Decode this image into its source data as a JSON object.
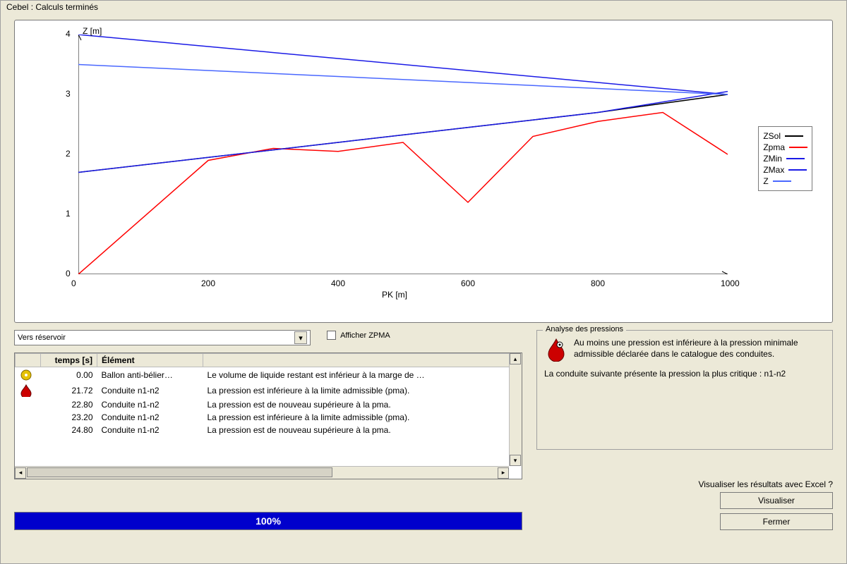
{
  "window": {
    "title": "Cebel : Calculs terminés"
  },
  "chart_data": {
    "type": "line",
    "xlabel": "PK [m]",
    "ylabel": "Z [m]",
    "xlim": [
      0,
      1000
    ],
    "ylim": [
      0,
      4
    ],
    "xticks": [
      0,
      200,
      400,
      600,
      800,
      1000
    ],
    "yticks": [
      0,
      1,
      2,
      3,
      4
    ],
    "series": [
      {
        "name": "ZSol",
        "color": "#000000",
        "x": [
          0,
          200,
          400,
          600,
          800,
          1000
        ],
        "y": [
          1.7,
          1.95,
          2.2,
          2.45,
          2.7,
          3.0
        ]
      },
      {
        "name": "Zpma",
        "color": "#ff0000",
        "x": [
          0,
          200,
          300,
          400,
          500,
          600,
          700,
          800,
          900,
          1000
        ],
        "y": [
          0.0,
          1.9,
          2.1,
          2.05,
          2.2,
          1.2,
          2.3,
          2.55,
          2.7,
          2.0
        ]
      },
      {
        "name": "ZMin",
        "color": "#1a1ae6",
        "x": [
          0,
          200,
          400,
          600,
          800,
          1000
        ],
        "y": [
          1.7,
          1.95,
          2.2,
          2.45,
          2.7,
          3.05
        ]
      },
      {
        "name": "ZMax",
        "color": "#1a1ae6",
        "x": [
          0,
          200,
          400,
          600,
          800,
          1000
        ],
        "y": [
          4.0,
          3.8,
          3.6,
          3.4,
          3.2,
          3.0
        ]
      },
      {
        "name": "Z",
        "color": "#4a68ff",
        "x": [
          0,
          200,
          400,
          600,
          800,
          1000
        ],
        "y": [
          3.5,
          3.4,
          3.3,
          3.2,
          3.1,
          3.0
        ]
      }
    ]
  },
  "dropdown": {
    "selected": "Vers réservoir"
  },
  "checkbox": {
    "label": "Afficher ZPMA",
    "checked": false
  },
  "analysis": {
    "title": "Analyse des pressions",
    "text1": "Au moins une pression est inférieure à la pression minimale admissible déclarée dans le catalogue des conduites.",
    "text2": "La conduite suivante présente la pression la plus critique : n1-n2"
  },
  "table": {
    "headers": {
      "icon": "",
      "temps": "temps [s]",
      "element": "Élément",
      "message": ""
    },
    "rows": [
      {
        "icon": "warning-yellow",
        "temps": "0.00",
        "element": "Ballon anti-bélier…",
        "message": "Le volume de liquide restant est inférieur à la marge de …"
      },
      {
        "icon": "warning-red",
        "temps": "21.72",
        "element": "Conduite n1-n2",
        "message": "La pression est inférieure à la limite admissible (pma)."
      },
      {
        "icon": "",
        "temps": "22.80",
        "element": "Conduite n1-n2",
        "message": "La pression est de nouveau supérieure à la pma."
      },
      {
        "icon": "",
        "temps": "23.20",
        "element": "Conduite n1-n2",
        "message": "La pression est inférieure à la limite admissible (pma)."
      },
      {
        "icon": "",
        "temps": "24.80",
        "element": "Conduite n1-n2",
        "message": "La pression est de nouveau supérieure à la pma."
      }
    ]
  },
  "result_prompt": "Visualiser les résultats avec Excel ?",
  "buttons": {
    "visualiser": "Visualiser",
    "fermer": "Fermer"
  },
  "progress": {
    "percent": "100%"
  }
}
